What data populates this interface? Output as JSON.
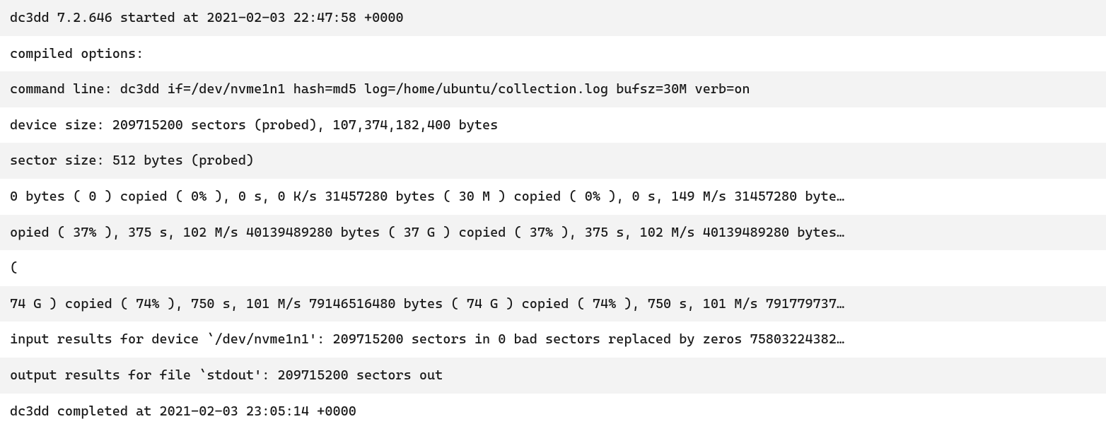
{
  "terminal": {
    "lines": [
      "dc3dd 7.2.646 started at 2021-02-03 22:47:58 +0000",
      "compiled options:",
      "command line: dc3dd if=/dev/nvme1n1 hash=md5 log=/home/ubuntu/collection.log bufsz=30M verb=on",
      "device size: 209715200 sectors (probed), 107,374,182,400 bytes",
      "sector size: 512 bytes (probed)",
      "0 bytes ( 0 ) copied ( 0% ), 0 s, 0 K/s 31457280 bytes ( 30 M ) copied ( 0% ), 0 s, 149 M/s 31457280 byte…",
      "opied ( 37% ), 375 s, 102 M/s 40139489280 bytes ( 37 G ) copied ( 37% ), 375 s, 102 M/s 40139489280 bytes…",
      "(",
      "74 G ) copied ( 74% ), 750 s, 101 M/s 79146516480 bytes ( 74 G ) copied ( 74% ), 750 s, 101 M/s 791779737…",
      "input results for device `/dev/nvme1n1': 209715200 sectors in 0 bad sectors replaced by zeros 75803224382…",
      "output results for file `stdout': 209715200 sectors out",
      "dc3dd completed at 2021-02-03 23:05:14 +0000"
    ]
  }
}
